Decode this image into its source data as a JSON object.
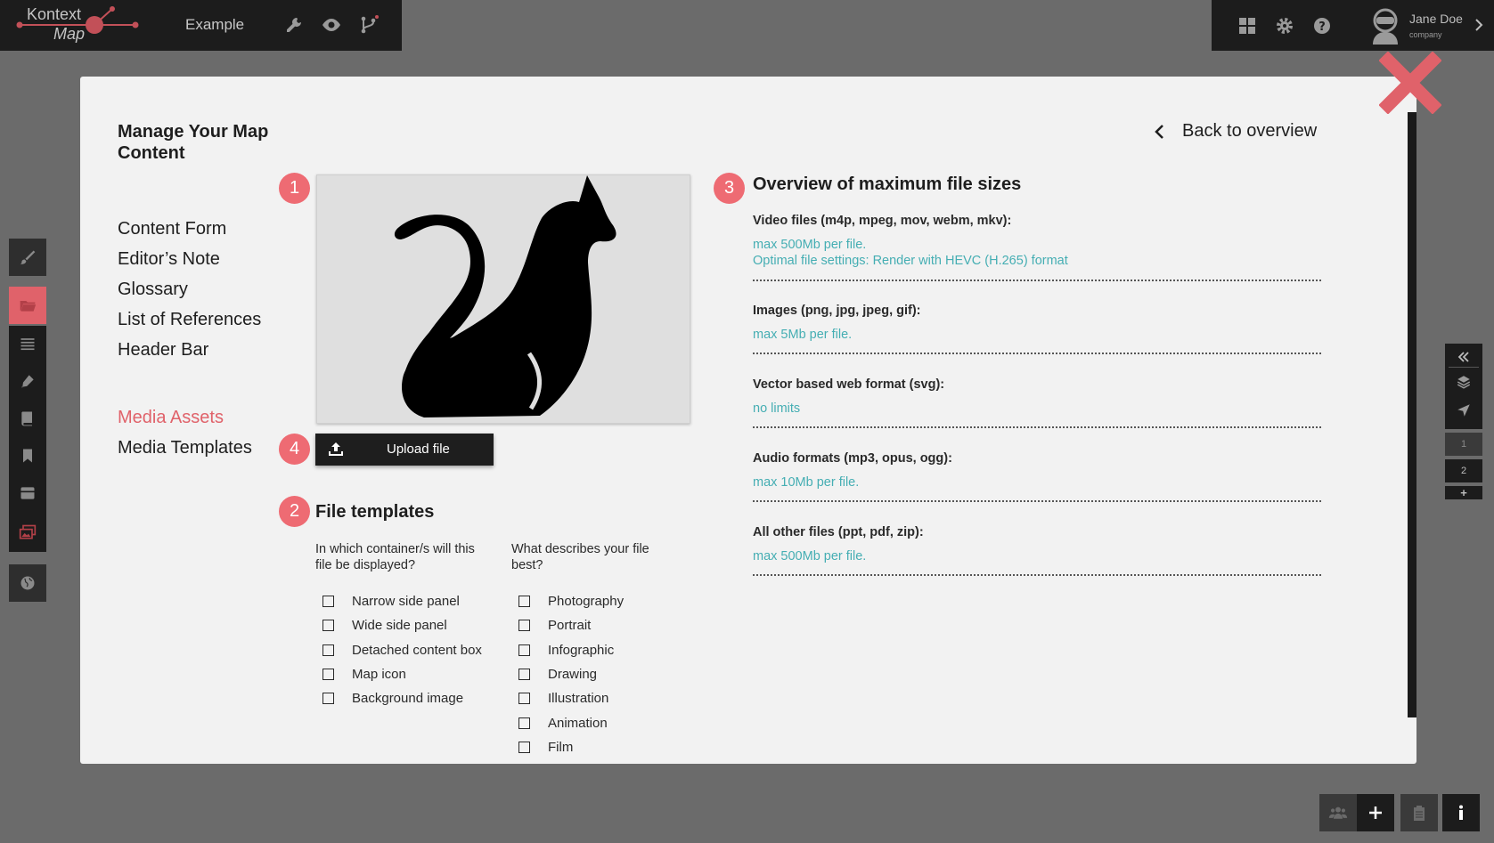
{
  "header": {
    "logo_top": "Kontext",
    "logo_bottom": "Map",
    "project_title": "Example",
    "icons": [
      "wrench-icon",
      "eye-icon",
      "branch-icon"
    ]
  },
  "user_bar": {
    "icons": [
      "grid-icon",
      "gear-icon",
      "help-icon"
    ],
    "user_name": "Jane Doe",
    "user_company": "company"
  },
  "left_toolbar": {
    "icons": [
      "brush-icon",
      "folder-icon",
      "list-icon",
      "pen-icon",
      "book-icon",
      "bookmark-icon",
      "inbox-icon",
      "images-icon",
      "globe-icon"
    ]
  },
  "right_toolbar": {
    "icons": [
      "collapse-left-icon",
      "layers-icon",
      "navigate-icon"
    ],
    "pages": [
      "1",
      "2"
    ],
    "add_label": "+"
  },
  "bottom_toolbar": {
    "icons": [
      "users-icon",
      "plus-icon",
      "clipboard-icon",
      "info-icon"
    ]
  },
  "modal": {
    "title": "Manage Your Map Content",
    "back_label": "Back to overview",
    "nav_items": [
      {
        "label": "Content Form"
      },
      {
        "label": "Editor’s Note"
      },
      {
        "label": "Glossary"
      },
      {
        "label": "List of References"
      },
      {
        "label": "Header Bar"
      }
    ],
    "nav_items_2": [
      {
        "label": "Media Assets",
        "active": true
      },
      {
        "label": "Media Templates"
      }
    ],
    "badges": [
      "1",
      "2",
      "3",
      "4"
    ],
    "upload_label": "Upload file",
    "file_templates": {
      "heading": "File templates",
      "container_question": "In which container/s will this file be displayed?",
      "describe_question": "What describes your file best?",
      "container_options": [
        "Narrow side panel",
        "Wide side panel",
        "Detached content box",
        "Map icon",
        "Background image"
      ],
      "describe_options": [
        "Photography",
        "Portrait",
        "Infographic",
        "Drawing",
        "Illustration",
        "Animation",
        "Film"
      ]
    },
    "overview": {
      "heading": "Overview of maximum file sizes",
      "items": [
        {
          "label": "Video files (m4p, mpeg, mov, webm, mkv):",
          "values": [
            "max 500Mb per file.",
            "Optimal file settings: Render with HEVC (H.265) format"
          ]
        },
        {
          "label": "Images (png, jpg, jpeg, gif):",
          "values": [
            "max 5Mb per file."
          ]
        },
        {
          "label": "Vector based web format (svg):",
          "values": [
            "no limits"
          ]
        },
        {
          "label": "Audio formats (mp3, opus, ogg):",
          "values": [
            "max 10Mb per file."
          ]
        },
        {
          "label": "All other files (ppt, pdf, zip):",
          "values": [
            "max 500Mb per file."
          ]
        }
      ]
    }
  },
  "colors": {
    "accent": "#ee6b73",
    "active_nav": "#e0626a",
    "info_text": "#45aeb3",
    "bar_bg": "#1c1c1c",
    "backdrop": "#6b6b6b"
  }
}
